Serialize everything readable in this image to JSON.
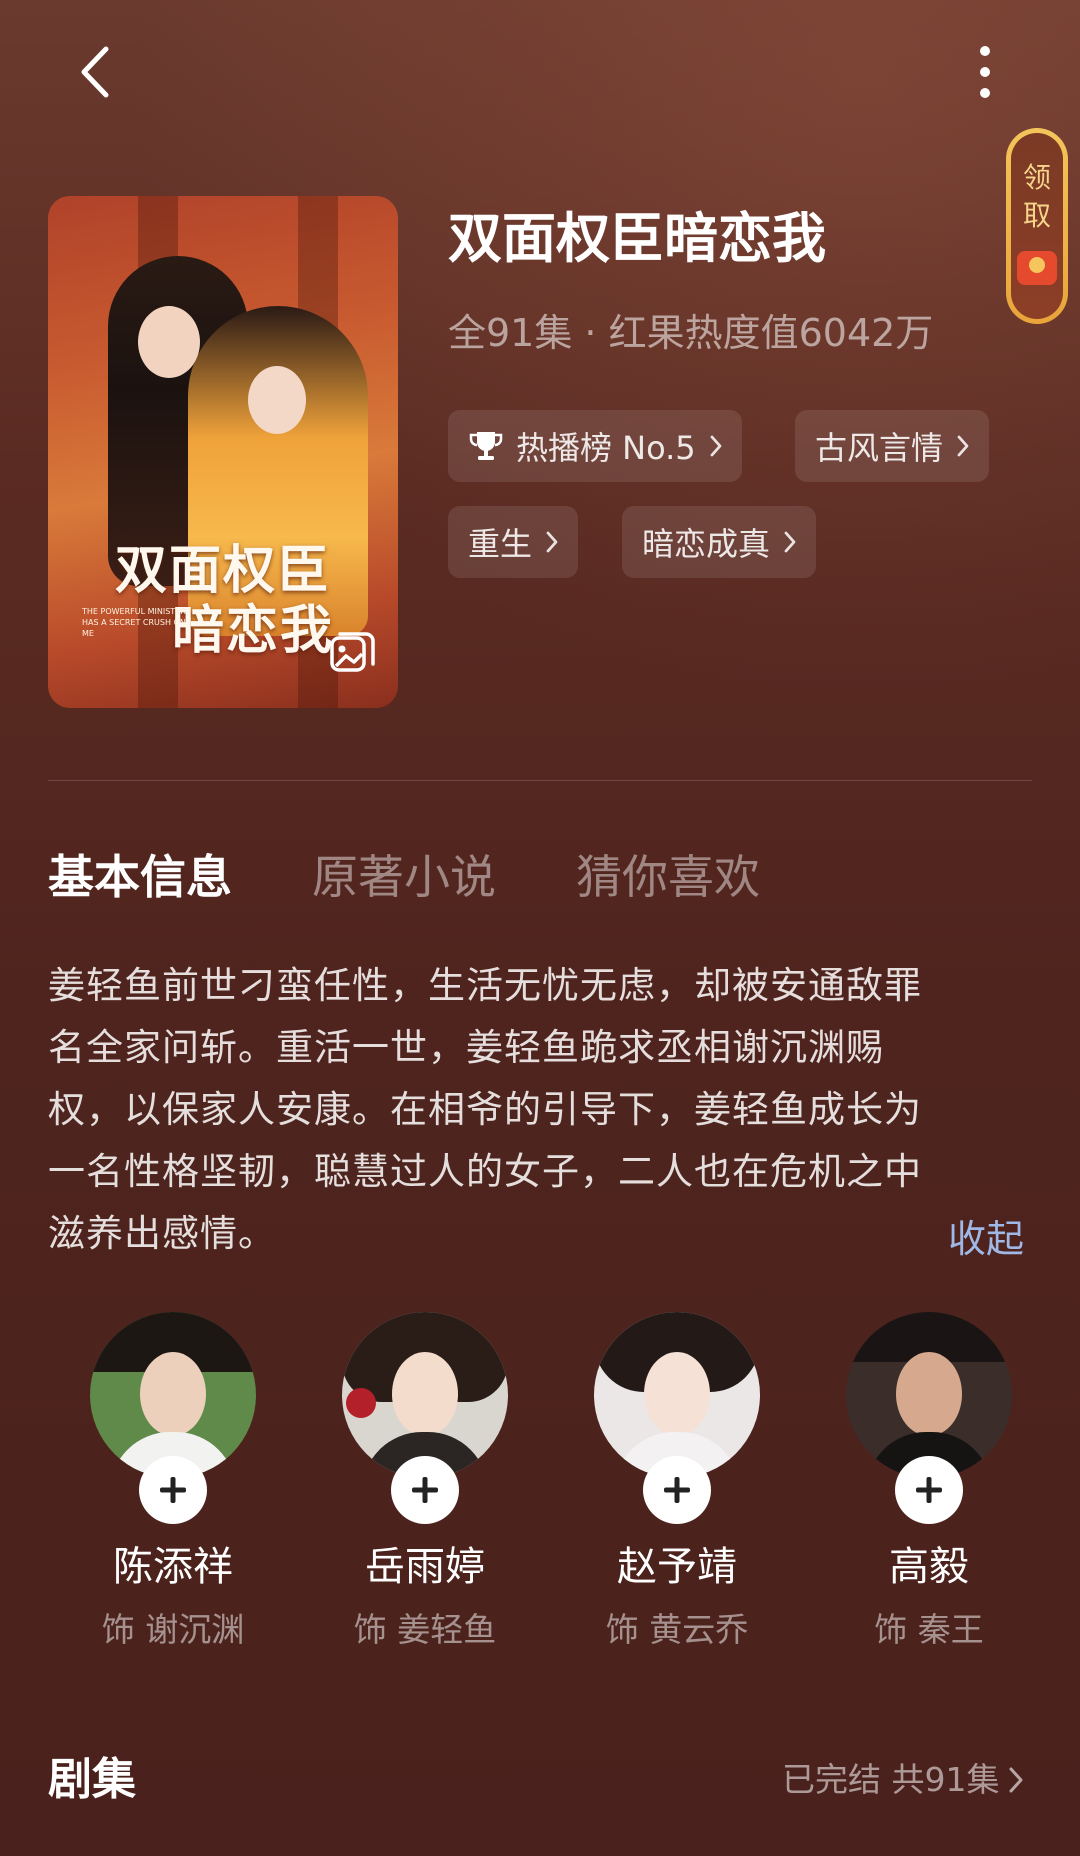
{
  "header": {
    "back_icon": "chevron-left-icon",
    "more_icon": "more-vertical-icon",
    "claim_label": "领取"
  },
  "show": {
    "title": "双面权臣暗恋我",
    "meta": "全91集 · 红果热度值6042万",
    "poster_title_line1": "双面权臣",
    "poster_title_line2": "暗恋我",
    "poster_subtitle": "THE POWERFUL MINISTER HAS A SECRET CRUSH ON ME",
    "tags": [
      {
        "label": "热播榜 No.5",
        "icon": "trophy-icon"
      },
      {
        "label": "古风言情"
      },
      {
        "label": "重生"
      },
      {
        "label": "暗恋成真"
      }
    ]
  },
  "tabs": [
    {
      "label": "基本信息",
      "active": true
    },
    {
      "label": "原著小说",
      "active": false
    },
    {
      "label": "猜你喜欢",
      "active": false
    }
  ],
  "synopsis": {
    "lines": [
      "姜轻鱼前世刁蛮任性，生活无忧无虑，却被安通敌罪",
      "名全家问斩。重活一世，姜轻鱼跪求丞相谢沉渊赐",
      "权，以保家人安康。在相爷的引导下，姜轻鱼成长为",
      "一名性格坚韧，聪慧过人的女子，二人也在危机之中",
      "滋养出感情。"
    ],
    "collapse_label": "收起"
  },
  "cast": [
    {
      "name": "陈添祥",
      "role": "饰 谢沉渊"
    },
    {
      "name": "岳雨婷",
      "role": "饰 姜轻鱼"
    },
    {
      "name": "赵予靖",
      "role": "饰 黄云乔"
    },
    {
      "name": "高毅",
      "role": "饰 秦王"
    }
  ],
  "episodes": {
    "title": "剧集",
    "status": "已完结 共91集"
  },
  "colors": {
    "accent_link": "#9fb8e6",
    "claim_gold": "#f3c55a",
    "background_top": "#6b3a2e",
    "background_bottom": "#4a211c"
  }
}
